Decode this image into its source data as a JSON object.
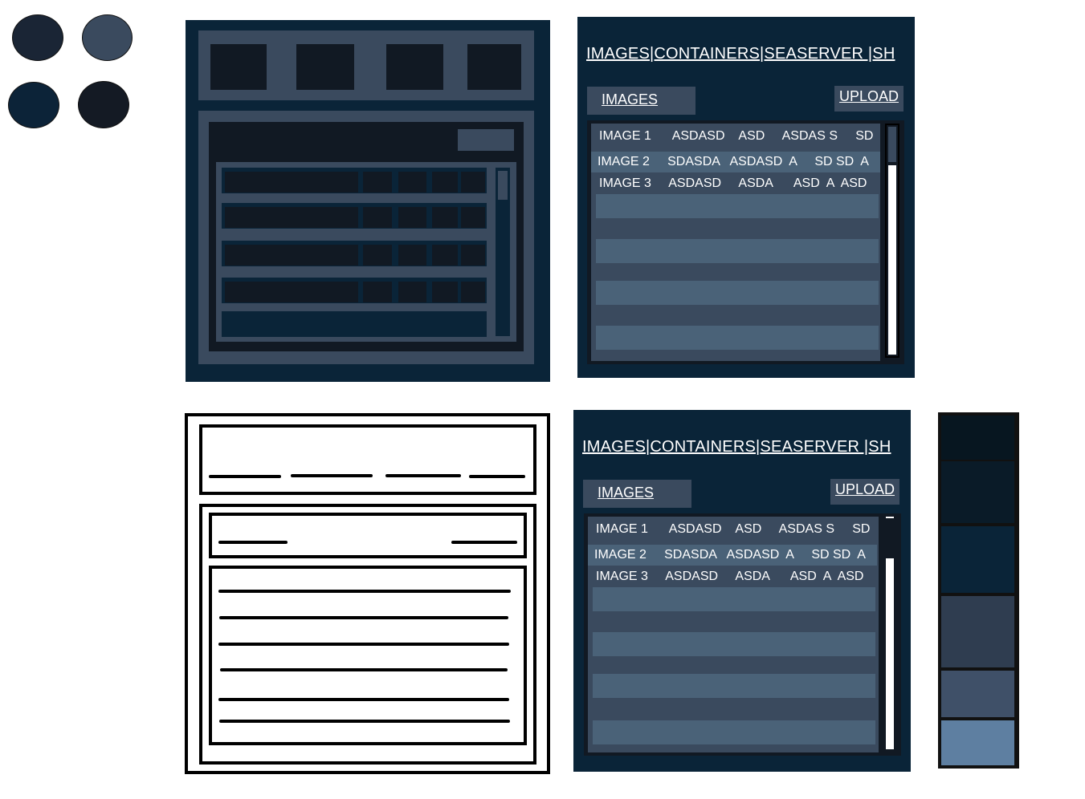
{
  "palette_dots": [
    "#1a2535",
    "#3a4a5e",
    "#0c2338",
    "#141a24"
  ],
  "palette_swatches": [
    "#071620",
    "#0a1b28",
    "#0a2438",
    "#2f3d50",
    "#3f5068",
    "#5e7fa1"
  ],
  "screens": [
    {
      "nav_label": "IMAGES|CONTAINERS|SEASERVER |SH",
      "tab_label": "IMAGES",
      "upload_label": "UPLOAD",
      "rows": [
        "IMAGE 1      ASDASD    ASD     ASDAS S     SD",
        "IMAGE 2     SDASDA   ASDASD  A     SD SD  A",
        "IMAGE 3     ASDASD     ASDA      ASD  A  ASD"
      ]
    },
    {
      "nav_label": "IMAGES|CONTAINERS|SEASERVER |SH",
      "tab_label": "IMAGES",
      "upload_label": "UPLOAD",
      "rows": [
        "IMAGE 1      ASDASD    ASD     ASDAS S     SD",
        "IMAGE 2     SDASDA   ASDASD  A     SD SD  A",
        "IMAGE 3     ASDASD     ASDA      ASD  A  ASD"
      ]
    }
  ]
}
